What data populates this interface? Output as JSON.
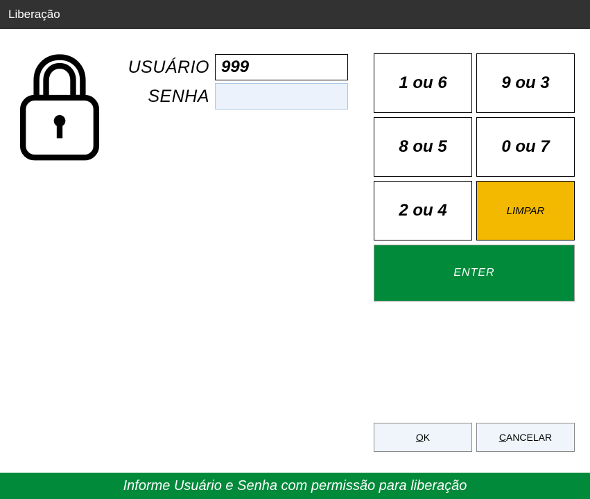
{
  "title": "Liberação",
  "form": {
    "user_label": "USUÁRIO",
    "user_value": "999",
    "pass_label": "SENHA",
    "pass_value": ""
  },
  "keypad": {
    "key_1": "1 ou 6",
    "key_2": "9 ou 3",
    "key_3": "8 ou 5",
    "key_4": "0 ou 7",
    "key_5": "2 ou 4",
    "clear": "LIMPAR",
    "enter": "ENTER"
  },
  "buttons": {
    "ok_prefix": "O",
    "ok_rest": "K",
    "cancel_prefix": "C",
    "cancel_rest": "ANCELAR"
  },
  "status": "Informe Usuário e Senha com permissão para liberação"
}
